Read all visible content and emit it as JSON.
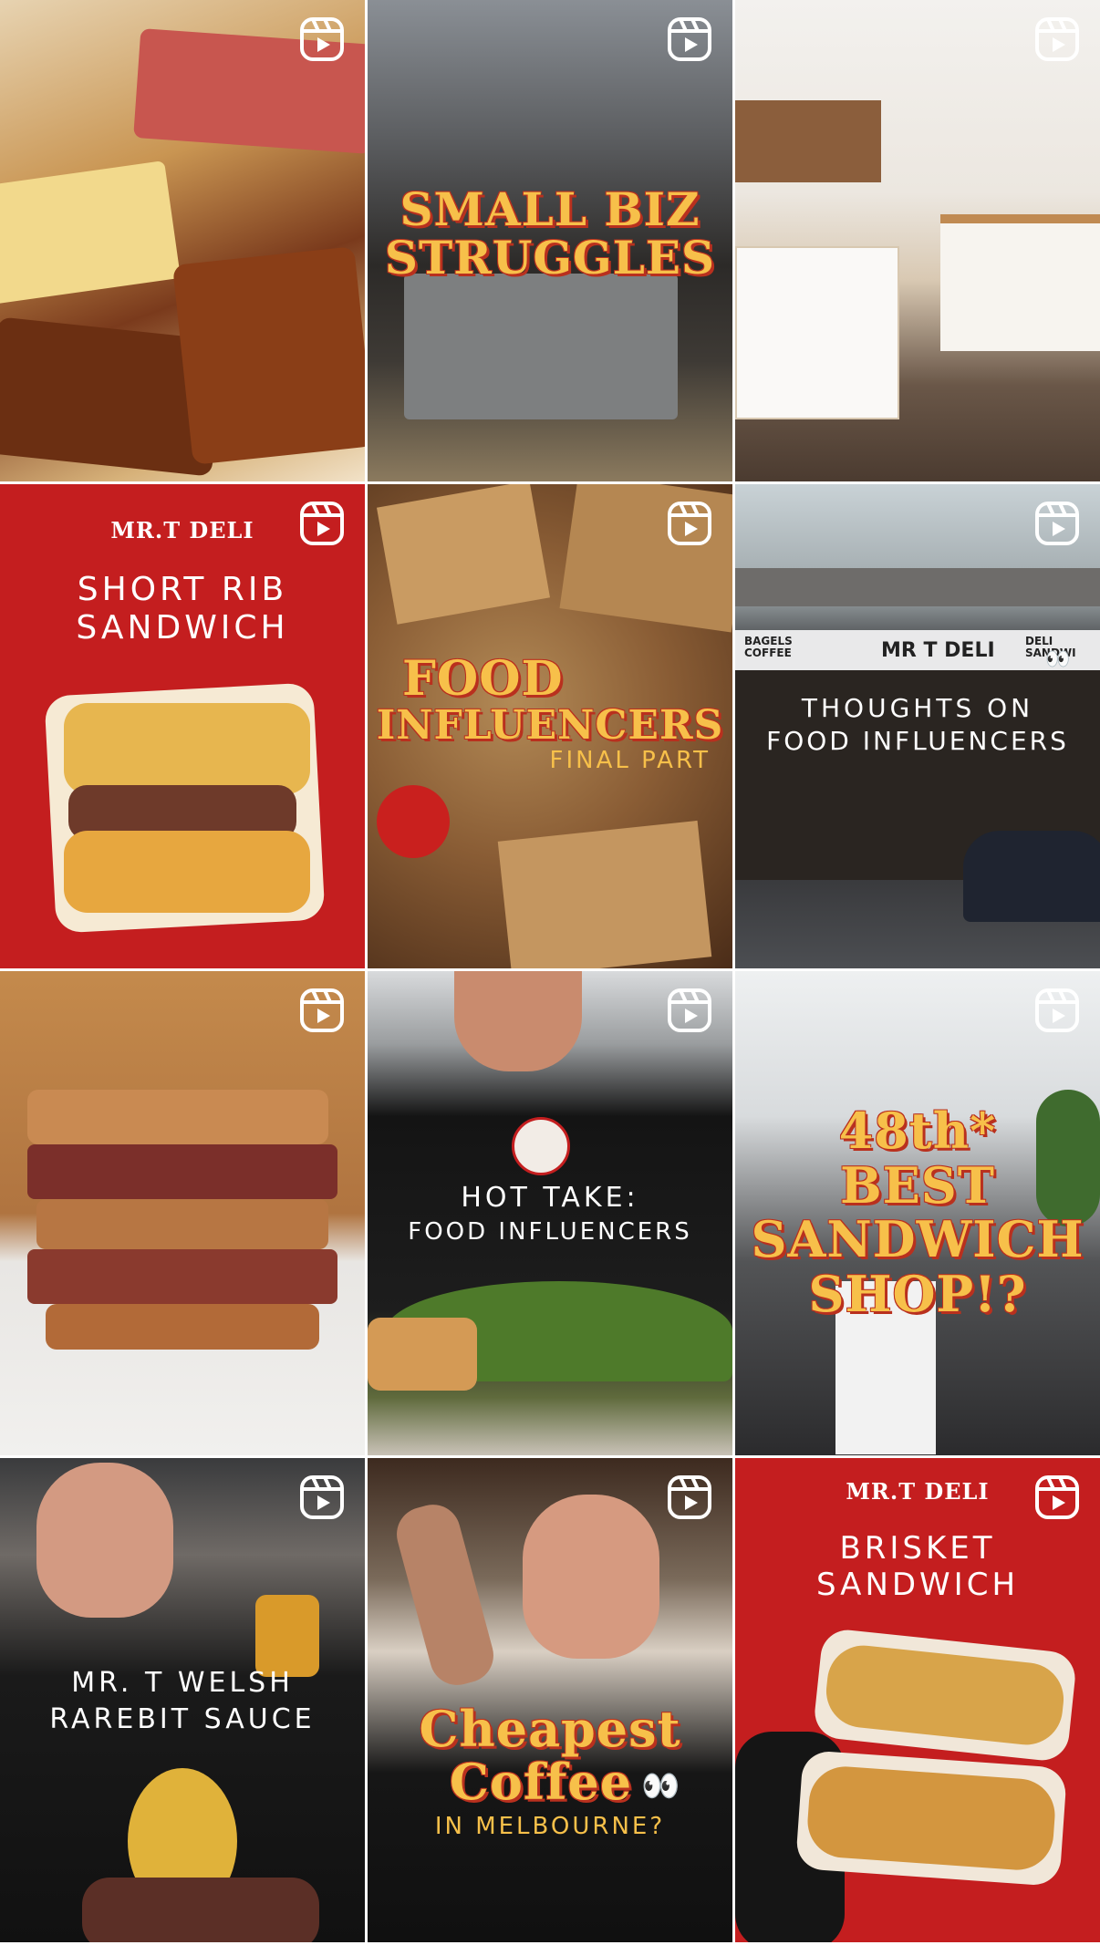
{
  "icons": {
    "reel": "reel-icon"
  },
  "tiles": [
    {
      "id": 1,
      "overlay": []
    },
    {
      "id": 2,
      "overlay": [
        "SMALL BIZ",
        "STRUGGLES"
      ]
    },
    {
      "id": 3,
      "overlay": []
    },
    {
      "id": 4,
      "brand": "MR.T DELI",
      "overlay": [
        "SHORT RIB",
        "SANDWICH"
      ]
    },
    {
      "id": 5,
      "overlay": [
        "FOOD",
        "INFLUENCERS",
        "FINAL PART"
      ]
    },
    {
      "id": 6,
      "sign": [
        "BAGELS",
        "COFFEE",
        "MR T DELI",
        "DELI",
        "SANDWI"
      ],
      "overlay": [
        "THOUGHTS ON",
        "FOOD INFLUENCERS"
      ],
      "emoji": "👀"
    },
    {
      "id": 7,
      "overlay": []
    },
    {
      "id": 8,
      "overlay": [
        "HOT TAKE:",
        "FOOD INFLUENCERS"
      ]
    },
    {
      "id": 9,
      "overlay": [
        "48th*",
        "BEST",
        "SANDWICH",
        "SHOP!?"
      ]
    },
    {
      "id": 10,
      "overlay": [
        "MR. T WELSH",
        "RAREBIT SAUCE"
      ]
    },
    {
      "id": 11,
      "overlay": [
        "Cheapest",
        "Coffee",
        "IN MELBOURNE?"
      ],
      "emoji": "👀"
    },
    {
      "id": 12,
      "brand": "MR.T DELI",
      "overlay": [
        "BRISKET",
        "SANDWICH"
      ]
    }
  ],
  "colors": {
    "brand_red": "#c41e1f",
    "retro_yellow": "#f7c04a",
    "retro_shadow": "#b9301e"
  }
}
